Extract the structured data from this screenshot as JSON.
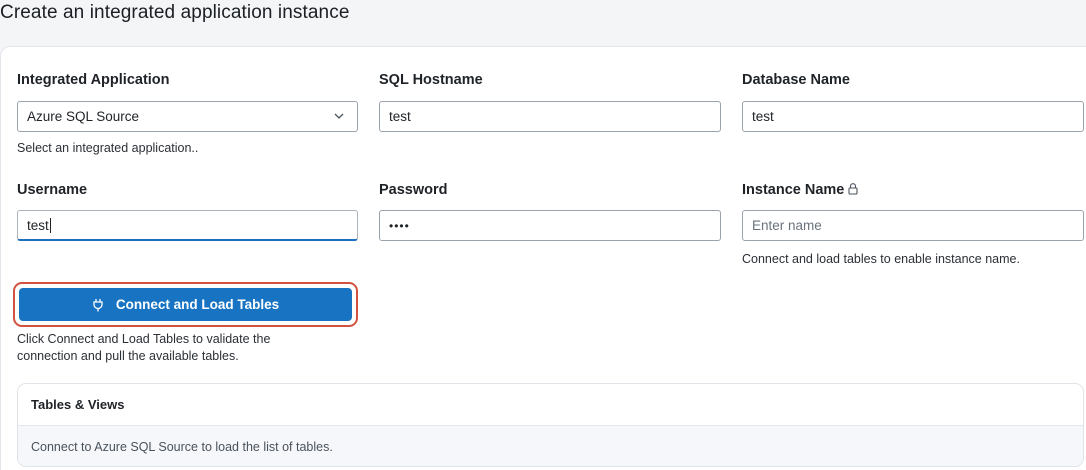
{
  "page": {
    "title": "Create an integrated application instance"
  },
  "form": {
    "integrated_application": {
      "label": "Integrated Application",
      "value": "Azure SQL Source",
      "help": "Select an integrated application.."
    },
    "sql_hostname": {
      "label": "SQL Hostname",
      "value": "test"
    },
    "database_name": {
      "label": "Database Name",
      "value": "test"
    },
    "username": {
      "label": "Username",
      "value": "test"
    },
    "password": {
      "label": "Password",
      "value": "••••"
    },
    "instance_name": {
      "label": "Instance Name",
      "placeholder": "Enter name",
      "help": "Connect and load tables to enable instance name."
    }
  },
  "connect": {
    "label": "Connect and Load Tables",
    "help_line1": "Click Connect and Load Tables to validate the",
    "help_line2": "connection and pull the available tables."
  },
  "tables": {
    "title": "Tables & Views",
    "empty_message": "Connect to Azure SQL Source to load the list of tables."
  },
  "icons": {
    "dropdown": "chevron-down-icon",
    "lock": "lock-icon",
    "plug": "plug-icon"
  },
  "colors": {
    "primary": "#1874c2",
    "highlight": "#d2523f",
    "active_underline": "#1f6fc0"
  }
}
